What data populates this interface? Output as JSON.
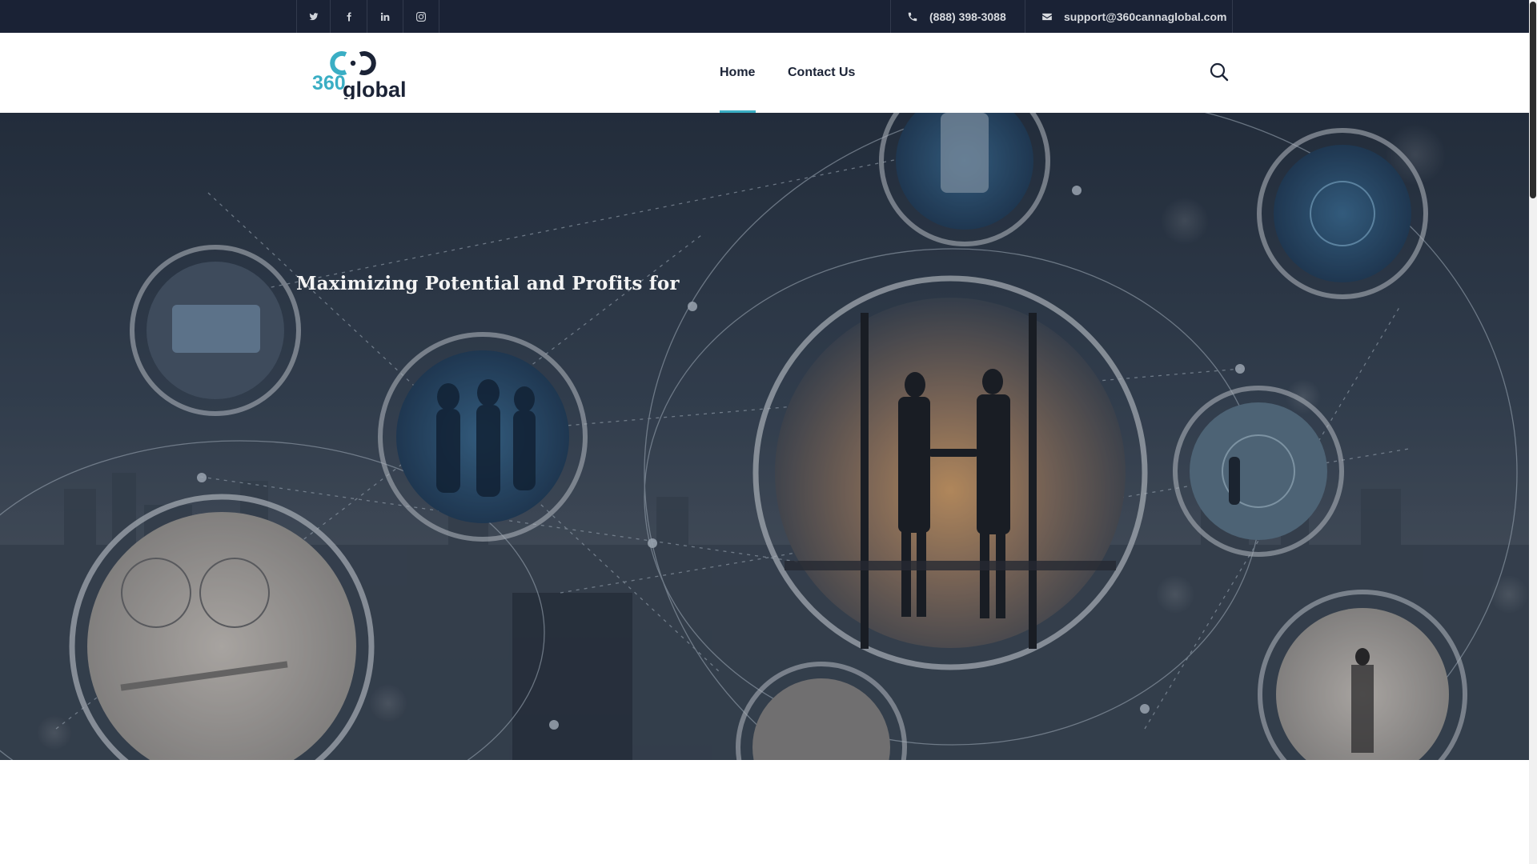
{
  "topbar": {
    "social": [
      {
        "name": "twitter",
        "icon": "twitter-icon"
      },
      {
        "name": "facebook",
        "icon": "facebook-icon"
      },
      {
        "name": "linkedin",
        "icon": "linkedin-icon"
      },
      {
        "name": "instagram",
        "icon": "instagram-icon"
      }
    ],
    "phone": "(888) 398-3088",
    "email": "support@360cannaglobal.com",
    "phone_icon": "phone-icon",
    "email_icon": "envelope-icon"
  },
  "header": {
    "logo_text_top": "360",
    "logo_text_bottom": "global",
    "nav": [
      {
        "label": "Home",
        "active": true
      },
      {
        "label": "Contact Us",
        "active": false
      }
    ],
    "search_icon": "search-icon"
  },
  "hero": {
    "title": "Maximizing Potential and Profits for"
  },
  "colors": {
    "topbar_bg": "#1a2235",
    "accent": "#3aaec4",
    "nav_text": "#1b2336",
    "logo_teal": "#3aaec4",
    "logo_dark": "#1b2336"
  }
}
